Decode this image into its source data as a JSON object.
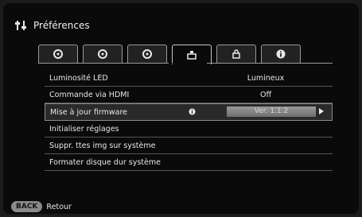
{
  "header": {
    "title": "Préférences",
    "icon": "settings-sliders-icon"
  },
  "tabs": [
    {
      "icon": "gear-1-icon"
    },
    {
      "icon": "gear-2-icon"
    },
    {
      "icon": "gear-3-icon"
    },
    {
      "icon": "camera-settings-icon",
      "active": true
    },
    {
      "icon": "lock-icon"
    },
    {
      "icon": "info-icon"
    }
  ],
  "menu": {
    "led_brightness": {
      "label": "Luminosité LED",
      "value": "Lumineux"
    },
    "hdmi_control": {
      "label": "Commande via HDMI",
      "value": "Off"
    },
    "firmware": {
      "label": "Mise à jour firmware",
      "value": "Ver. 1.1.2"
    },
    "reset": {
      "label": "Initialiser réglages"
    },
    "delete_images": {
      "label": "Suppr. ttes img sur système"
    },
    "format_disk": {
      "label": "Formater disque dur système"
    }
  },
  "footer": {
    "back_button": "BACK",
    "back_label": "Retour"
  }
}
